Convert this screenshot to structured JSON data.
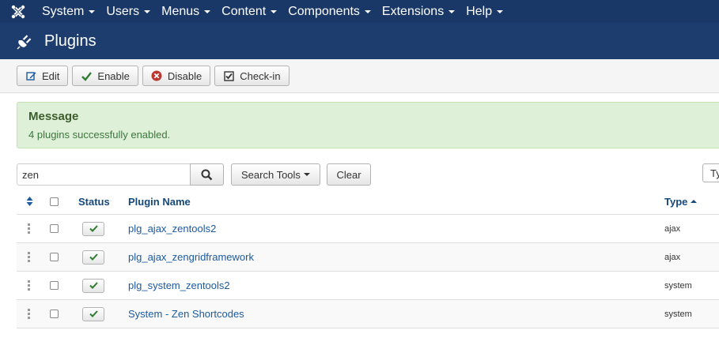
{
  "nav": {
    "logo_icon": "joomla-logo-icon",
    "items": [
      {
        "label": "System"
      },
      {
        "label": "Users"
      },
      {
        "label": "Menus"
      },
      {
        "label": "Content"
      },
      {
        "label": "Components"
      },
      {
        "label": "Extensions"
      },
      {
        "label": "Help"
      }
    ]
  },
  "header": {
    "title": "Plugins",
    "icon": "plug-icon"
  },
  "toolbar": {
    "edit_label": "Edit",
    "enable_label": "Enable",
    "disable_label": "Disable",
    "checkin_label": "Check-in"
  },
  "message": {
    "title": "Message",
    "text": "4 plugins successfully enabled."
  },
  "search": {
    "value": "zen",
    "tools_label": "Search Tools",
    "clear_label": "Clear",
    "type_select_label": "Ty"
  },
  "table": {
    "headers": {
      "status": "Status",
      "name": "Plugin Name",
      "type": "Type"
    },
    "rows": [
      {
        "name": "plg_ajax_zentools2",
        "type": "ajax",
        "enabled": true
      },
      {
        "name": "plg_ajax_zengridframework",
        "type": "ajax",
        "enabled": true
      },
      {
        "name": "plg_system_zentools2",
        "type": "system",
        "enabled": true
      },
      {
        "name": "System - Zen Shortcodes",
        "type": "system",
        "enabled": true
      }
    ]
  },
  "colors": {
    "nav_bg": "#1a3867",
    "header_bg": "#1c3d6e",
    "message_bg": "#dff0d8",
    "link": "#1c5aa0",
    "enabled_check": "#2e7d32"
  }
}
